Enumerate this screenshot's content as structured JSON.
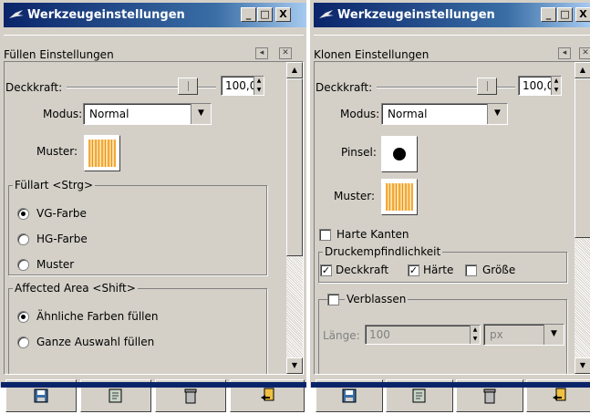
{
  "left": {
    "window_title": "Werkzeugeinstellungen",
    "title_buttons": [
      "_",
      "□",
      "X"
    ],
    "panel_title": "Füllen Einstellungen",
    "opacity_label": "Deckkraft:",
    "opacity_value": "100,0",
    "opacity_level": 1.0,
    "mode_label": "Modus:",
    "mode_value": "Normal",
    "pattern_label": "Muster:",
    "fill_type_title": "Füllart  <Strg>",
    "fill_type_options": [
      "VG-Farbe",
      "HG-Farbe",
      "Muster"
    ],
    "fill_type_selected": "VG-Farbe",
    "affected_area_title": "Affected Area  <Shift>",
    "affected_area_options": [
      "Ähnliche Farben füllen",
      "Ganze Auswahl füllen"
    ],
    "affected_area_selected": "Ähnliche Farben füllen"
  },
  "right": {
    "window_title": "Werkzeugeinstellungen",
    "title_buttons": [
      "_",
      "□",
      "X"
    ],
    "panel_title": "Klonen Einstellungen",
    "opacity_label": "Deckkraft:",
    "opacity_value": "100,0",
    "opacity_level": 1.0,
    "mode_label": "Modus:",
    "mode_value": "Normal",
    "brush_label": "Pinsel:",
    "pattern_label": "Muster:",
    "hard_edges_label": "Harte Kanten",
    "hard_edges_checked": false,
    "pressure_title": "Druckempfindlichkeit",
    "pressure_opacity_label": "Deckkraft",
    "pressure_opacity_checked": true,
    "pressure_hardness_label": "Härte",
    "pressure_hardness_checked": true,
    "pressure_size_label": "Größe",
    "pressure_size_checked": false,
    "fade_label": "Verblassen",
    "fade_checked": false,
    "length_label": "Länge:",
    "length_value": "100",
    "length_unit": "px"
  },
  "toolbar_icons": [
    "save-icon",
    "restore-icon",
    "delete-icon",
    "reset-icon"
  ],
  "colors": {
    "titlebar": "#0a246a",
    "face": "#d4d0c8",
    "pattern": "#f4a83a"
  }
}
